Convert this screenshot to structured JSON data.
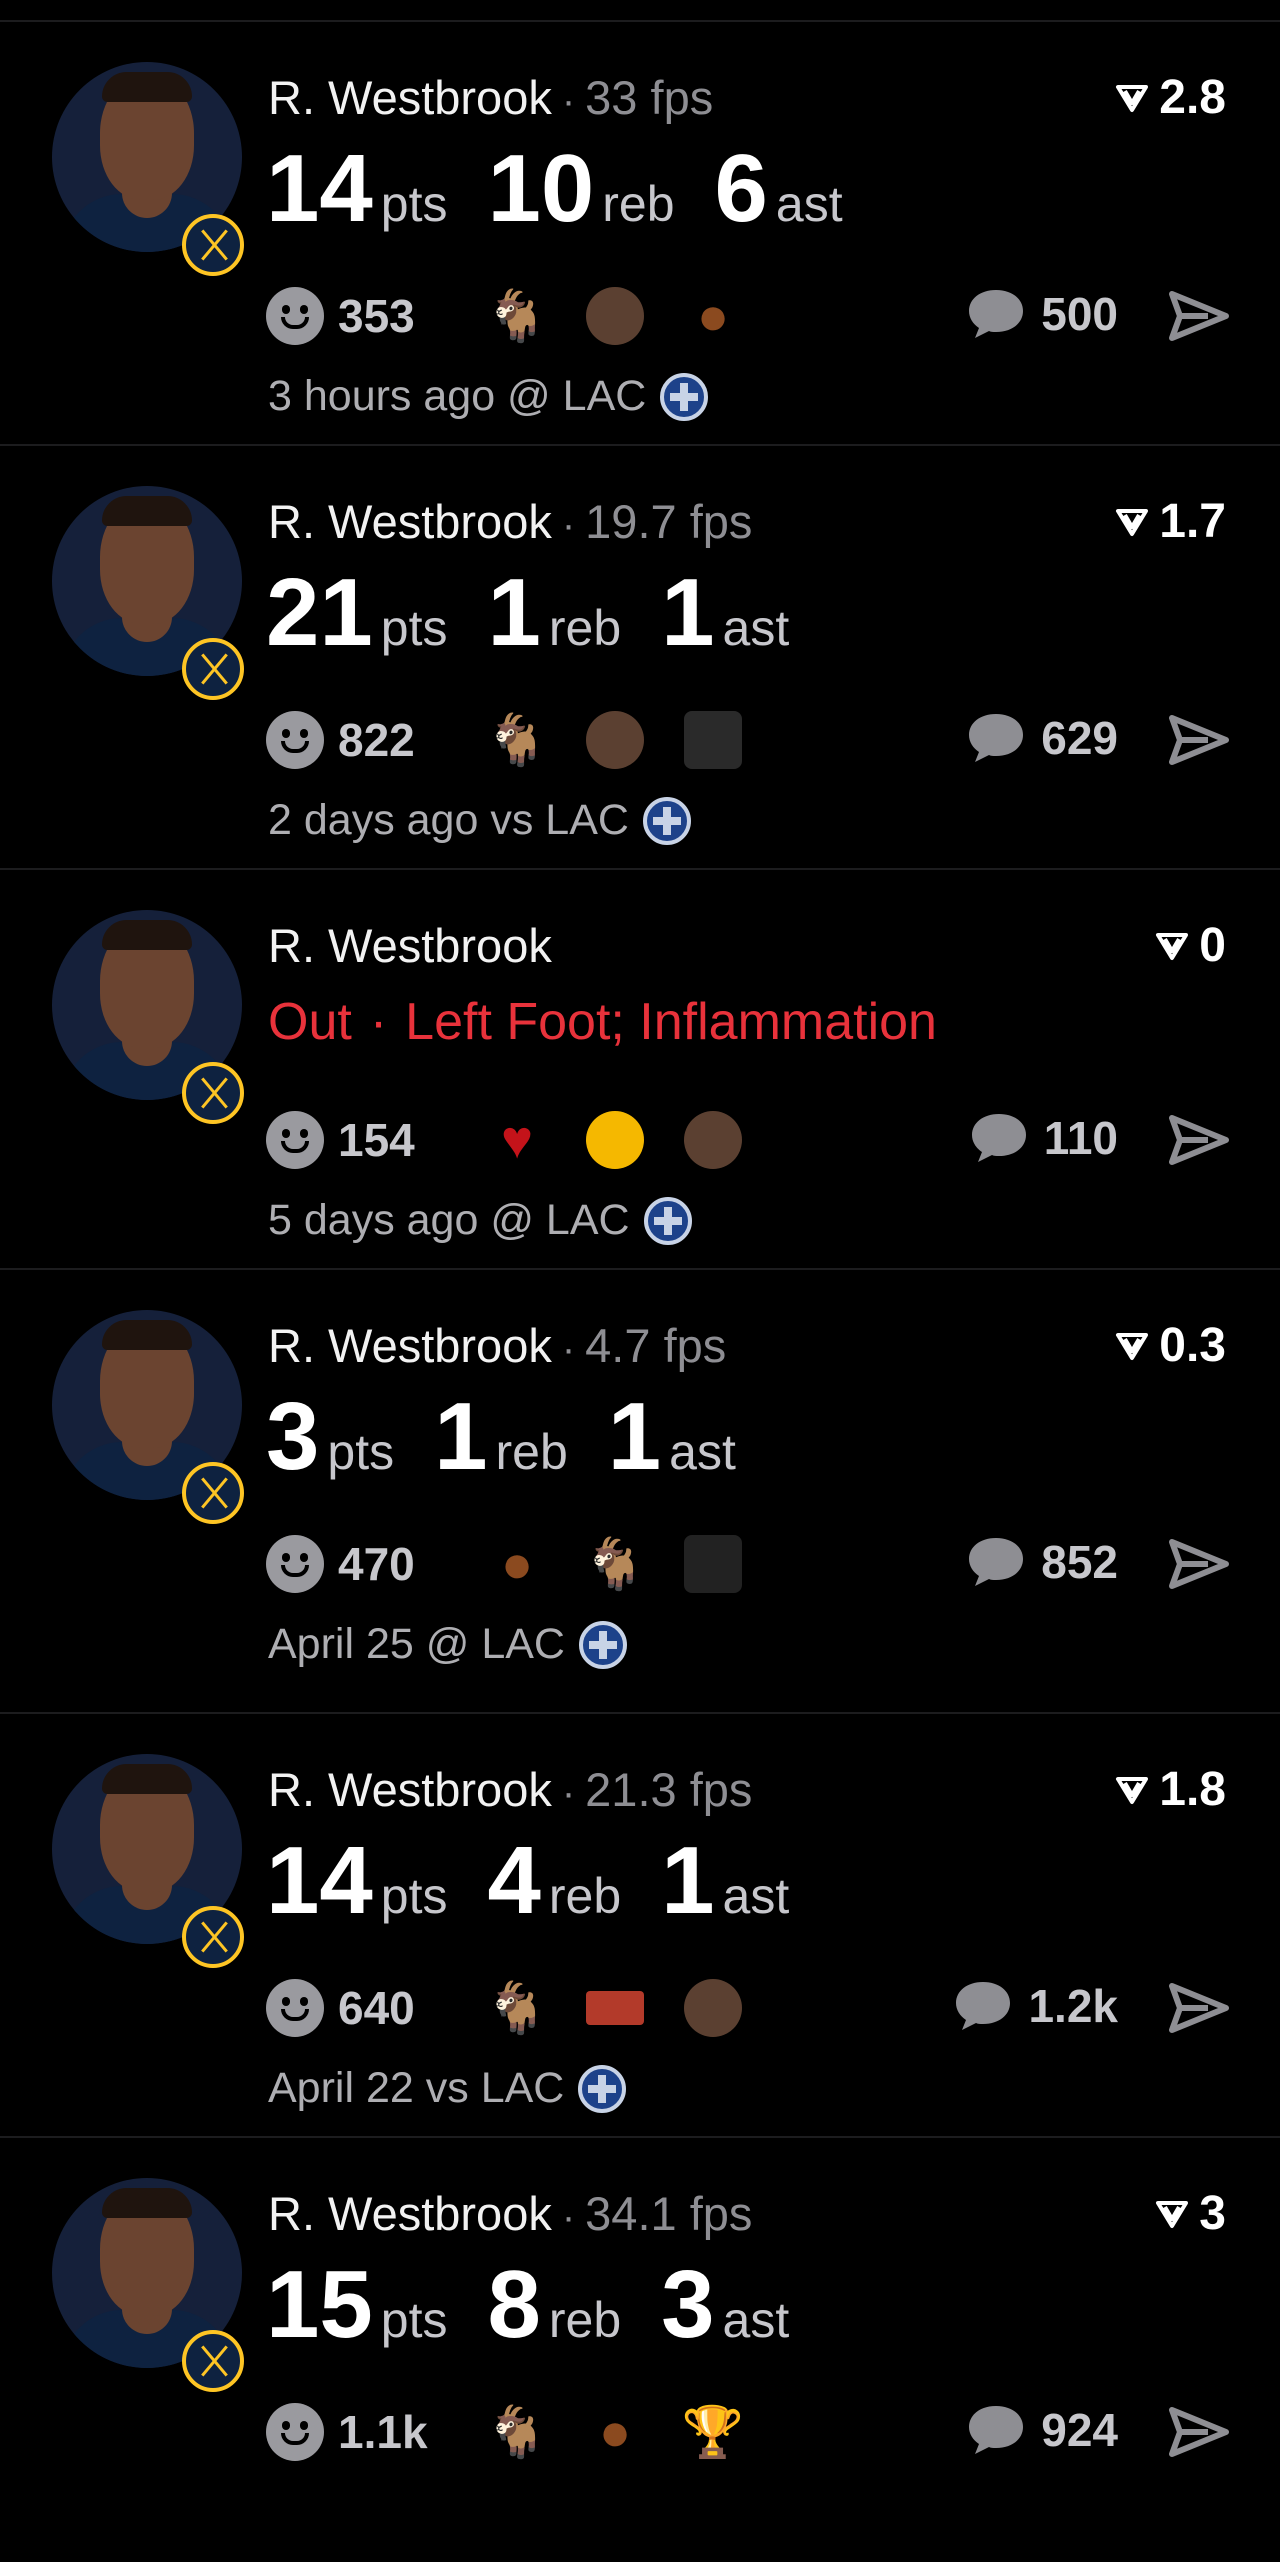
{
  "posts": [
    {
      "name": "R. Westbrook",
      "sep": "·",
      "fps": "33 fps",
      "score": "2.8",
      "pts": "14",
      "pts_label": "pts",
      "reb": "10",
      "reb_label": "reb",
      "ast": "6",
      "ast_label": "ast",
      "reactions": "353",
      "comments": "500",
      "meta": "3 hours ago @ LAC",
      "emojis": [
        "goat-emoji",
        "player-face-emoji",
        "poop-emoji"
      ]
    },
    {
      "name": "R. Westbrook",
      "sep": "·",
      "fps": "19.7 fps",
      "score": "1.7",
      "pts": "21",
      "pts_label": "pts",
      "reb": "1",
      "reb_label": "reb",
      "ast": "1",
      "ast_label": "ast",
      "reactions": "822",
      "comments": "629",
      "meta": "2 days ago vs LAC",
      "emojis": [
        "goat-emoji",
        "player-face-emoji",
        "player-celebrating-emoji"
      ]
    },
    {
      "name": "R. Westbrook",
      "status": "Out",
      "sep": "·",
      "injury": "Left Foot; Inflammation",
      "score": "0",
      "reactions": "154",
      "comments": "110",
      "meta": "5 days ago @ LAC",
      "emojis": [
        "broken-heart-emoji",
        "rolling-laughing-emoji",
        "shocked-face-emoji"
      ]
    },
    {
      "name": "R. Westbrook",
      "sep": "·",
      "fps": "4.7 fps",
      "score": "0.3",
      "pts": "3",
      "pts_label": "pts",
      "reb": "1",
      "reb_label": "reb",
      "ast": "1",
      "ast_label": "ast",
      "reactions": "470",
      "comments": "852",
      "meta": "April 25 @ LAC",
      "emojis": [
        "poop-emoji",
        "goat-emoji",
        "player-nets-emoji"
      ]
    },
    {
      "name": "R. Westbrook",
      "sep": "·",
      "fps": "21.3 fps",
      "score": "1.8",
      "pts": "14",
      "pts_label": "pts",
      "reb": "4",
      "reb_label": "reb",
      "ast": "1",
      "ast_label": "ast",
      "reactions": "640",
      "comments": "1.2k",
      "meta": "April 22 vs LAC",
      "emojis": [
        "goat-emoji",
        "brick-emoji",
        "player-face-emoji"
      ]
    },
    {
      "name": "R. Westbrook",
      "sep": "·",
      "fps": "34.1 fps",
      "score": "3",
      "pts": "15",
      "pts_label": "pts",
      "reb": "8",
      "reb_label": "reb",
      "ast": "3",
      "ast_label": "ast",
      "reactions": "1.1k",
      "comments": "924",
      "meta": "",
      "emojis": [
        "goat-emoji",
        "poop-emoji",
        "trophy-emoji"
      ]
    }
  ],
  "icons": {
    "upvote": "downward-chevron-score-icon",
    "comment": "speech-bubble-icon",
    "share": "paper-plane-icon",
    "reaction": "smiley-face-icon",
    "team": "nuggets-badge-icon",
    "opponent": "clippers-logo-icon"
  },
  "colors": {
    "background": "#000000",
    "injury": "#e8323b",
    "muted": "#8e8e93",
    "nuggets_gold": "#fec524"
  }
}
